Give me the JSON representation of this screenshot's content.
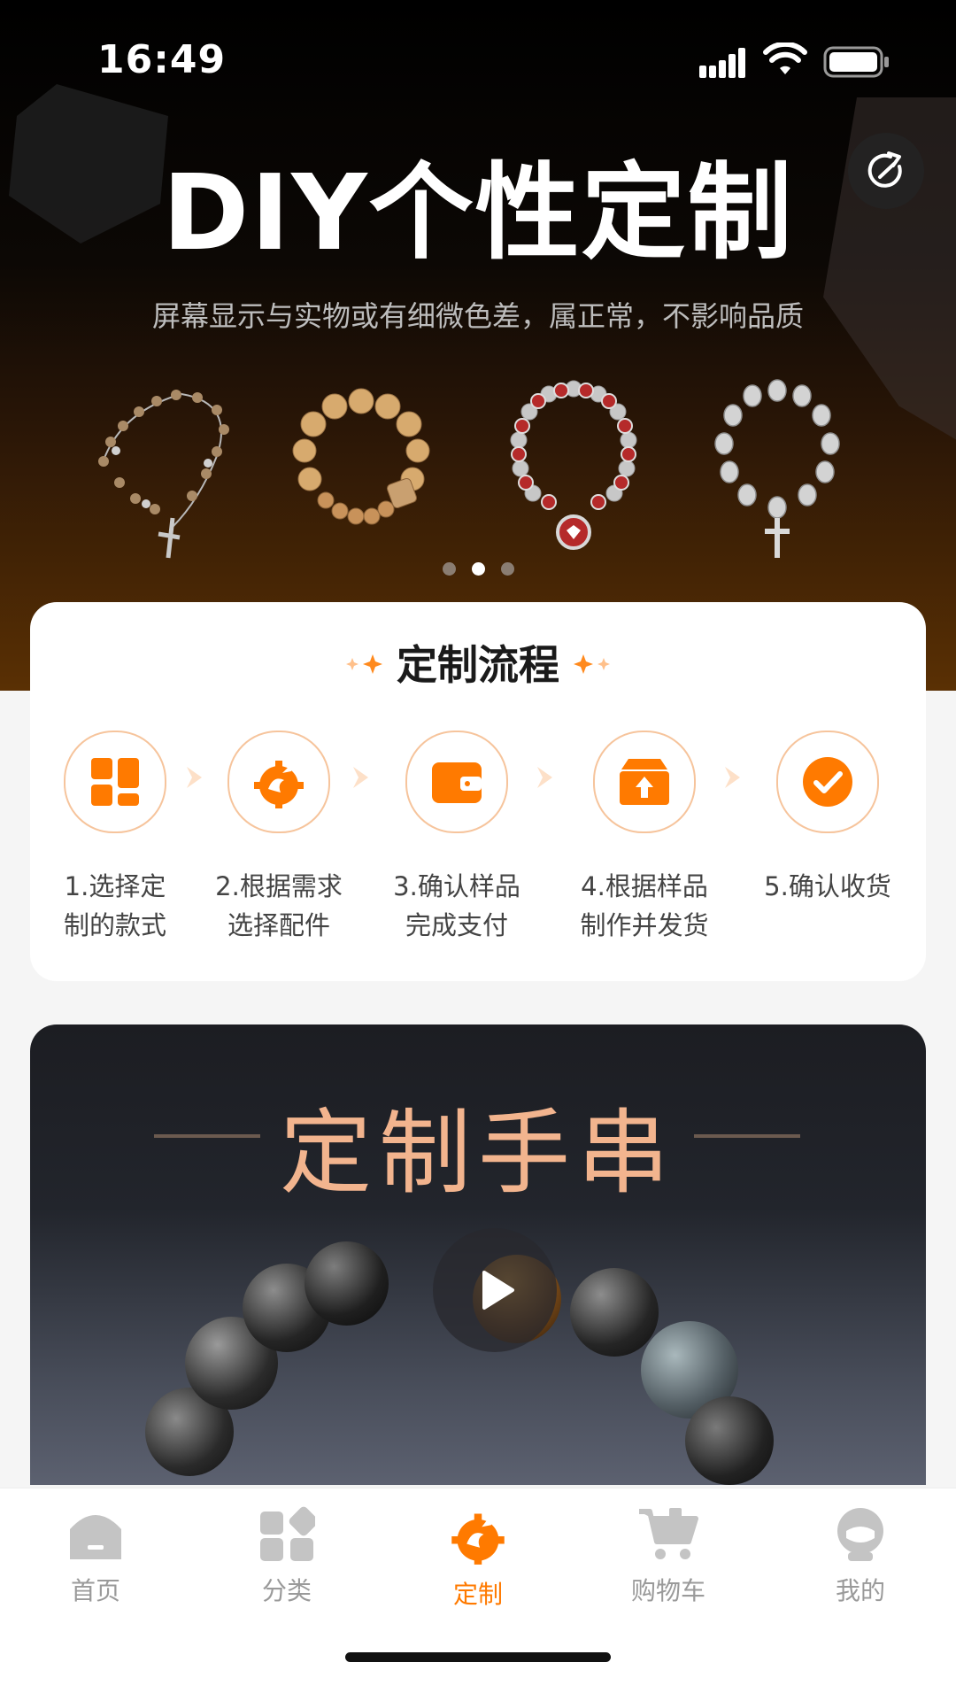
{
  "status_bar": {
    "time": "16:49"
  },
  "hero": {
    "title": "DIY个性定制",
    "subtitle": "屏幕显示与实物或有细微色差，属正常，不影响品质",
    "share_icon": "share-icon",
    "products": [
      "rosary-necklace",
      "wooden-bead-bracelet",
      "red-silver-bracelet",
      "silver-cross-bracelet"
    ],
    "carousel": {
      "count": 3,
      "active_index": 1
    }
  },
  "process": {
    "title": "定制流程",
    "steps": [
      {
        "label": "1.选择定\n制的款式",
        "icon": "grid-icon"
      },
      {
        "label": "2.根据需求\n选择配件",
        "icon": "dragon-gear-icon"
      },
      {
        "label": "3.确认样品\n完成支付",
        "icon": "wallet-icon"
      },
      {
        "label": "4.根据样品\n制作并发货",
        "icon": "box-upload-icon"
      },
      {
        "label": "5.确认收货",
        "icon": "check-icon"
      }
    ]
  },
  "video": {
    "title": "定制手串",
    "play_icon": "play-icon"
  },
  "tabbar": {
    "items": [
      {
        "label": "首页",
        "icon": "home-icon"
      },
      {
        "label": "分类",
        "icon": "category-icon"
      },
      {
        "label": "定制",
        "icon": "dragon-gear-icon"
      },
      {
        "label": "购物车",
        "icon": "cart-icon"
      },
      {
        "label": "我的",
        "icon": "profile-icon"
      }
    ],
    "active_index": 2
  },
  "colors": {
    "accent": "#ff7a00",
    "accent_light": "#f6c49c",
    "video_title": "#f2b48e"
  }
}
